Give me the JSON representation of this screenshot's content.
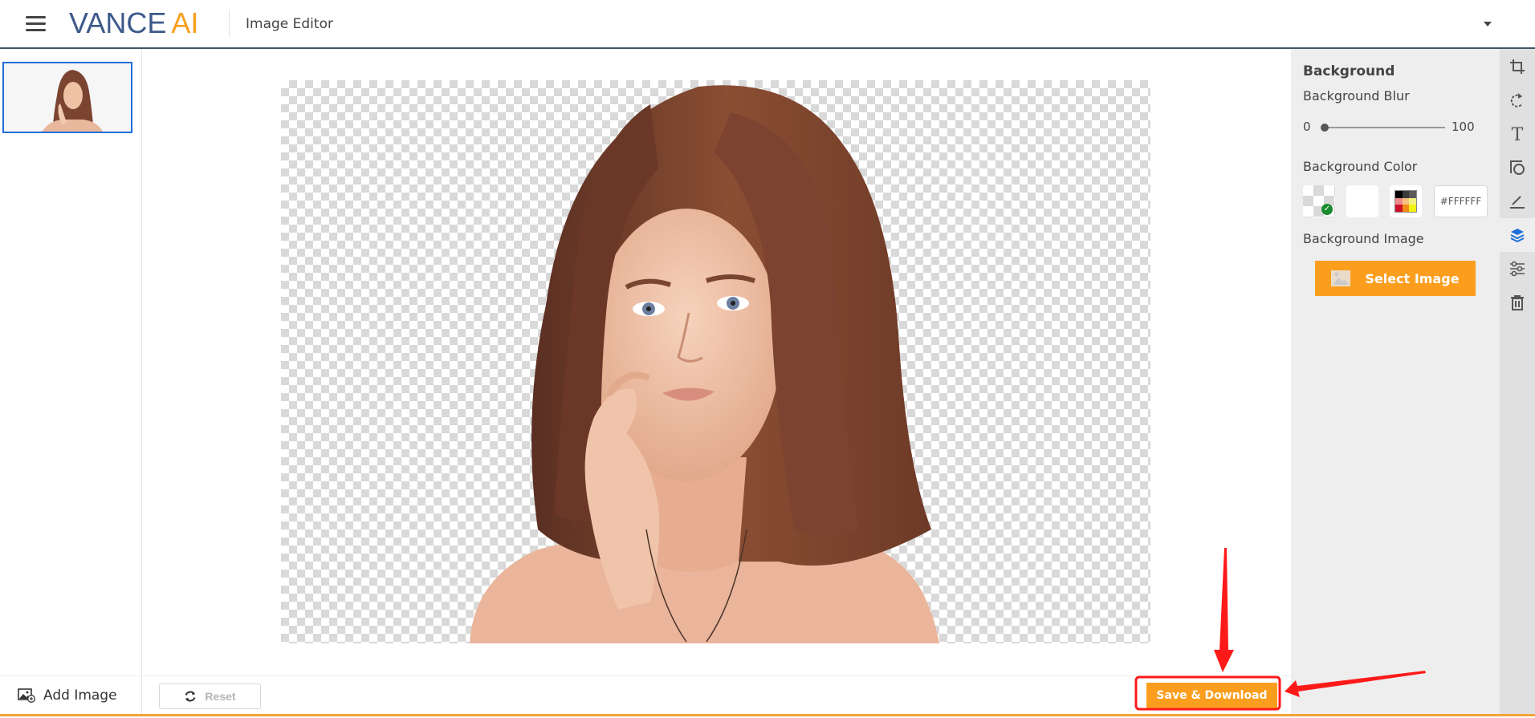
{
  "header": {
    "logo_primary": "VANCE",
    "logo_accent": "AI",
    "app_title": "Image Editor",
    "menu_icon": "hamburger-icon",
    "account_dropdown_icon": "caret-down-icon"
  },
  "sidebar": {
    "thumbnails": [
      {
        "label": "portrait-thumbnail",
        "selected": true
      }
    ],
    "add_image_label": "Add Image",
    "add_image_icon": "add-image-icon"
  },
  "bottom_bar": {
    "reset_label": "Reset",
    "reset_icon": "refresh-icon",
    "save_label": "Save & Download"
  },
  "panel": {
    "title": "Background",
    "blur_label": "Background Blur",
    "blur_min": "0",
    "blur_max": "100",
    "blur_value": 0,
    "color_label": "Background Color",
    "color_swatches": [
      {
        "name": "transparent",
        "selected": true
      },
      {
        "name": "white",
        "selected": false
      },
      {
        "name": "color-picker",
        "selected": false
      }
    ],
    "hex_value": "#FFFFFF",
    "image_label": "Background Image",
    "select_image_label": "Select Image"
  },
  "toolbar": {
    "tools": [
      {
        "name": "crop-icon",
        "active": false
      },
      {
        "name": "rotate-icon",
        "active": false
      },
      {
        "name": "text-icon",
        "active": false
      },
      {
        "name": "shape-icon",
        "active": false
      },
      {
        "name": "draw-icon",
        "active": false
      },
      {
        "name": "layers-icon",
        "active": true
      },
      {
        "name": "adjust-icon",
        "active": false
      },
      {
        "name": "delete-icon",
        "active": false
      }
    ]
  },
  "colors": {
    "brand_blue": "#3d5a8a",
    "brand_orange": "#f8a01e",
    "button_orange": "#fb9e1e",
    "selection_blue": "#1e6fd9",
    "annotation_red": "#ff1a1a",
    "check_green": "#1a8a2e"
  }
}
